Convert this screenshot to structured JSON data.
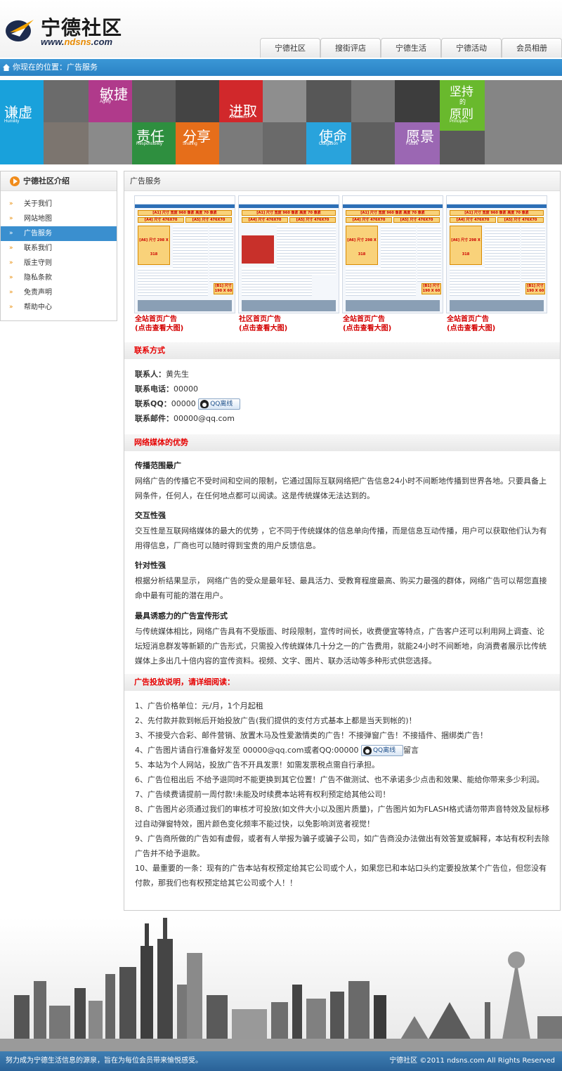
{
  "header": {
    "logo_title": "宁德社区",
    "logo_url_prefix": "www.",
    "logo_url_highlight": "ndsns",
    "logo_url_suffix": ".com",
    "nav": [
      "宁德社区",
      "搜街评店",
      "宁德生活",
      "宁德活动",
      "会员相册"
    ]
  },
  "breadcrumb": "你现在的位置：广告服务",
  "banner": {
    "words": [
      "谦虚",
      "敏捷",
      "责任",
      "分享",
      "进取",
      "使命",
      "愿景",
      "坚持",
      "的",
      "原则"
    ],
    "subs": [
      "Humility",
      "Agility",
      "Responsibility",
      "Sharing",
      "Ambitions",
      "Obligation",
      "Future",
      "Principles"
    ]
  },
  "sidebar": {
    "title": "宁德社区介绍",
    "items": [
      "关于我们",
      "网站地图",
      "广告服务",
      "联系我们",
      "版主守则",
      "隐私条款",
      "免责声明",
      "帮助中心"
    ],
    "active_index": 2
  },
  "main": {
    "title": "广告服务",
    "screenshots": [
      {
        "caption1": "全站首页广告",
        "caption2": "(点击查看大图)"
      },
      {
        "caption1": "社区首页广告",
        "caption2": "(点击查看大图)"
      },
      {
        "caption1": "全站首页广告",
        "caption2": "(点击查看大图)"
      },
      {
        "caption1": "全站首页广告",
        "caption2": "(点击查看大图)"
      }
    ],
    "shot_labels": {
      "a1": "[A1] 尺寸 宽度 960 像素 高度 70 像素",
      "a4": "[A4] 尺寸 476X70",
      "a5": "[A5] 尺寸 476X70",
      "a6": "[A6] 尺寸 298 X 318",
      "b1": "[B1] 尺寸 190 X 60"
    },
    "contact": {
      "heading": "联系方式",
      "person_label": "联系人：",
      "person": "黄先生",
      "phone_label": "联系电话：",
      "phone": "00000",
      "qq_label": "联系QQ：",
      "qq": "00000",
      "qq_button": "QQ离线",
      "email_label": "联系邮件：",
      "email": "00000@qq.com"
    },
    "advantages": {
      "heading": "网络媒体的优势",
      "items": [
        {
          "title": "传播范围最广",
          "text": "网络广告的传播它不受时间和空间的限制，它通过国际互联网络把广告信息24小时不间断地传播到世界各地。只要具备上网条件，任何人，在任何地点都可以阅读。这是传统媒体无法达到的。"
        },
        {
          "title": "交互性强",
          "text": "交互性是互联网络媒体的最大的优势 ，它不同于传统媒体的信息单向传播，而是信息互动传播，用户可以获取他们认为有用得信息，厂商也可以随时得到宝贵的用户反馈信息。"
        },
        {
          "title": "针对性强",
          "text": "根据分析结果显示， 网络广告的受众是最年轻、最具活力、受教育程度最高、购买力最强的群体，网络广告可以帮您直接命中最有可能的潜在用户。"
        },
        {
          "title": "最具诱惑力的广告宣传形式",
          "text": "与传统媒体相比，网络广告具有不受版面、时段限制，宣传时间长，收费便宜等特点，广告客户还可以利用网上调查、论坛短消息群发等新颖的广告形式，只需投入传统媒体几十分之一的广告费用，就能24小时不间断地，向消费者展示比传统媒体上多出几十倍内容的宣传资料。视频、文字、图片、联办活动等多种形式供您选择。"
        }
      ]
    },
    "rules": {
      "heading": "广告投放说明，请详细阅读：",
      "items": [
        "1、广告价格单位：元/月，1个月起租",
        "2、先付款并款到帐后开始投放广告(我们提供的支付方式基本上都是当天到帐的)！",
        "3、不接受六合彩、邮件营销、放置木马及性爱激情类的广告！不接弹窗广告！不接插件、捆绑类广告！",
        "4、广告图片请自行准备好发至 00000@qq.com或者QQ:00000",
        "5、本站为个人网站，投放广告不开具发票！如需发票税点需自行承担。",
        "6、广告位租出后 不给予退同时不能更换到其它位置！广告不做测试、也不承诺多少点击和效果、能给你带来多少利润。",
        "7、广告续费请提前一周付款!未能及时续费本站将有权利预定给其他公司！",
        "8、广告图片必须通过我们的审核才可投放(如文件大小以及图片质量)，广告图片如为FLASH格式请勿带声音特效及鼠标移过自动弹窗特效，图片颜色变化频率不能过快，以免影响浏览者视觉！",
        "9、广告商所做的广告如有虚假，或者有人举报为骗子或骗子公司，如广告商没办法做出有效答复或解释，本站有权利去除广告并不给予退款。",
        "10、最重要的一条：现有的广告本站有权预定给其它公司或个人，如果您已和本站口头约定要投放某个广告位，但您没有付款，那我们也有权预定给其它公司或个人！！"
      ],
      "qq_button": "QQ离线",
      "rule4_suffix": "留言"
    }
  },
  "footer": {
    "left": "努力成为宁德生活信息的源泉，旨在为每位会员带来愉悦感受。",
    "right": "宁德社区 ©2011 ndsns.com All Rights Reserved"
  },
  "colors": {
    "accent_blue": "#2a82c4",
    "accent_red": "#e60000",
    "accent_orange": "#e88a00"
  }
}
